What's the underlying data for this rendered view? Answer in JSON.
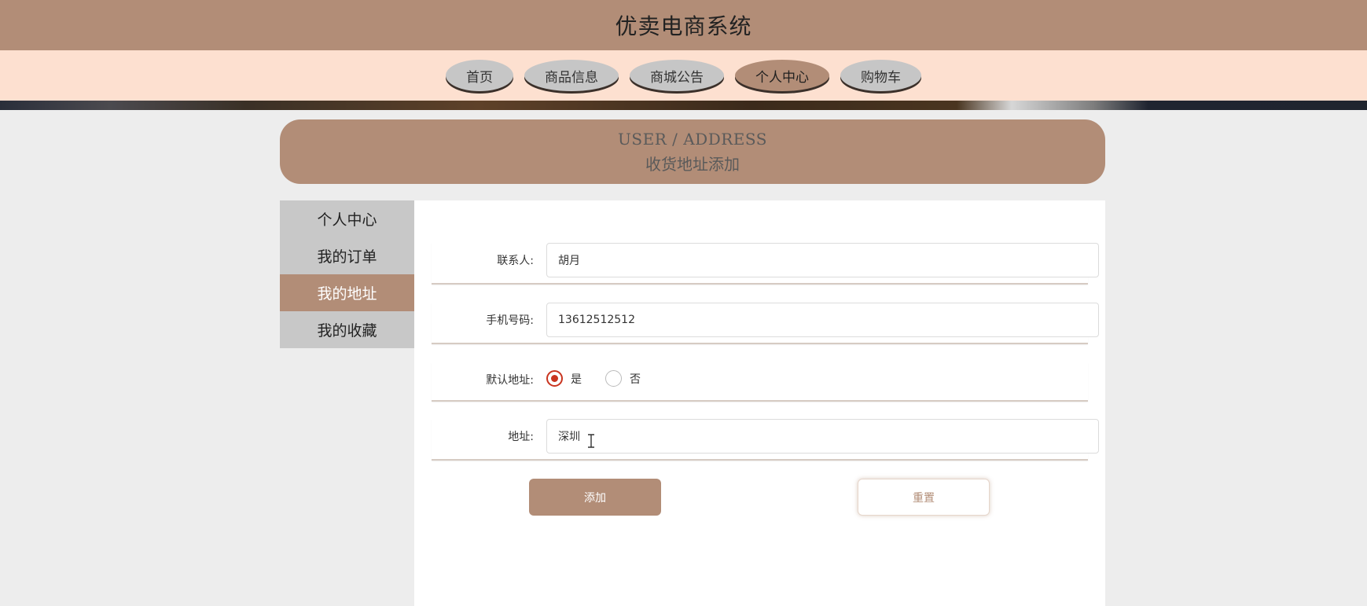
{
  "header": {
    "title": "优卖电商系统"
  },
  "nav": {
    "items": [
      {
        "label": "首页"
      },
      {
        "label": "商品信息"
      },
      {
        "label": "商城公告"
      },
      {
        "label": "个人中心"
      },
      {
        "label": "购物车"
      }
    ],
    "active_index": 3
  },
  "banner": {
    "en": "USER / ADDRESS",
    "zh": "收货地址添加"
  },
  "sidebar": {
    "items": [
      {
        "label": "个人中心"
      },
      {
        "label": "我的订单"
      },
      {
        "label": "我的地址"
      },
      {
        "label": "我的收藏"
      }
    ],
    "active_index": 2
  },
  "form": {
    "contact": {
      "label": "联系人:",
      "value": "胡月"
    },
    "phone": {
      "label": "手机号码:",
      "value": "13612512512"
    },
    "default_address": {
      "label": "默认地址:",
      "options": [
        {
          "label": "是",
          "checked": true
        },
        {
          "label": "否",
          "checked": false
        }
      ]
    },
    "address": {
      "label": "地址:",
      "value": "深圳"
    },
    "submit_label": "添加",
    "reset_label": "重置"
  },
  "colors": {
    "brand": "#b28d77",
    "nav_bg": "#fde0d0",
    "radio_accent": "#c9341f"
  }
}
